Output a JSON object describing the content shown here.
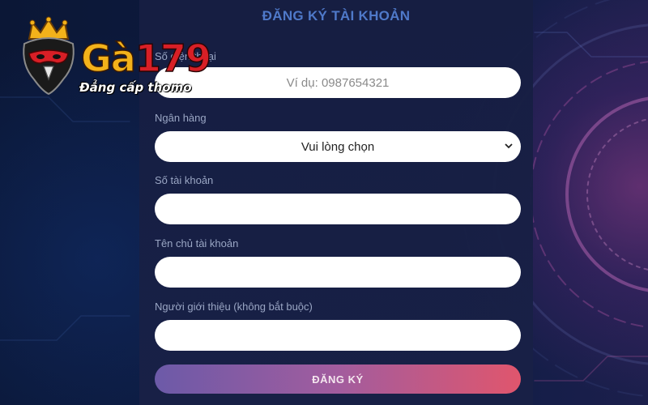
{
  "form": {
    "title": "ĐĂNG KÝ TÀI KHOẢN",
    "phone": {
      "label": "Số điện thoại",
      "placeholder": "Ví dụ: 0987654321"
    },
    "bank": {
      "label": "Ngân hàng",
      "selected": "Vui lòng chọn"
    },
    "account_number": {
      "label": "Số tài khoản",
      "value": ""
    },
    "account_holder": {
      "label": "Tên chủ tài khoản",
      "value": ""
    },
    "referrer": {
      "label": "Người giới thiệu (không bắt buộc)",
      "value": ""
    },
    "submit_label": "ĐĂNG KÝ"
  },
  "brand": {
    "name_text": "Gà",
    "name_number": "179",
    "tagline": "Đẳng cấp thomo",
    "colors": {
      "gold": "#f3b21a",
      "red": "#d81f26"
    }
  },
  "icons": {
    "logo": "rooster-crown-icon",
    "select": "chevron-down-icon"
  },
  "colors": {
    "title": "#4f79c9",
    "label": "#9aa6c4",
    "button_gradient": [
      "#6c5aa8",
      "#a25c9e",
      "#e0566d"
    ]
  }
}
